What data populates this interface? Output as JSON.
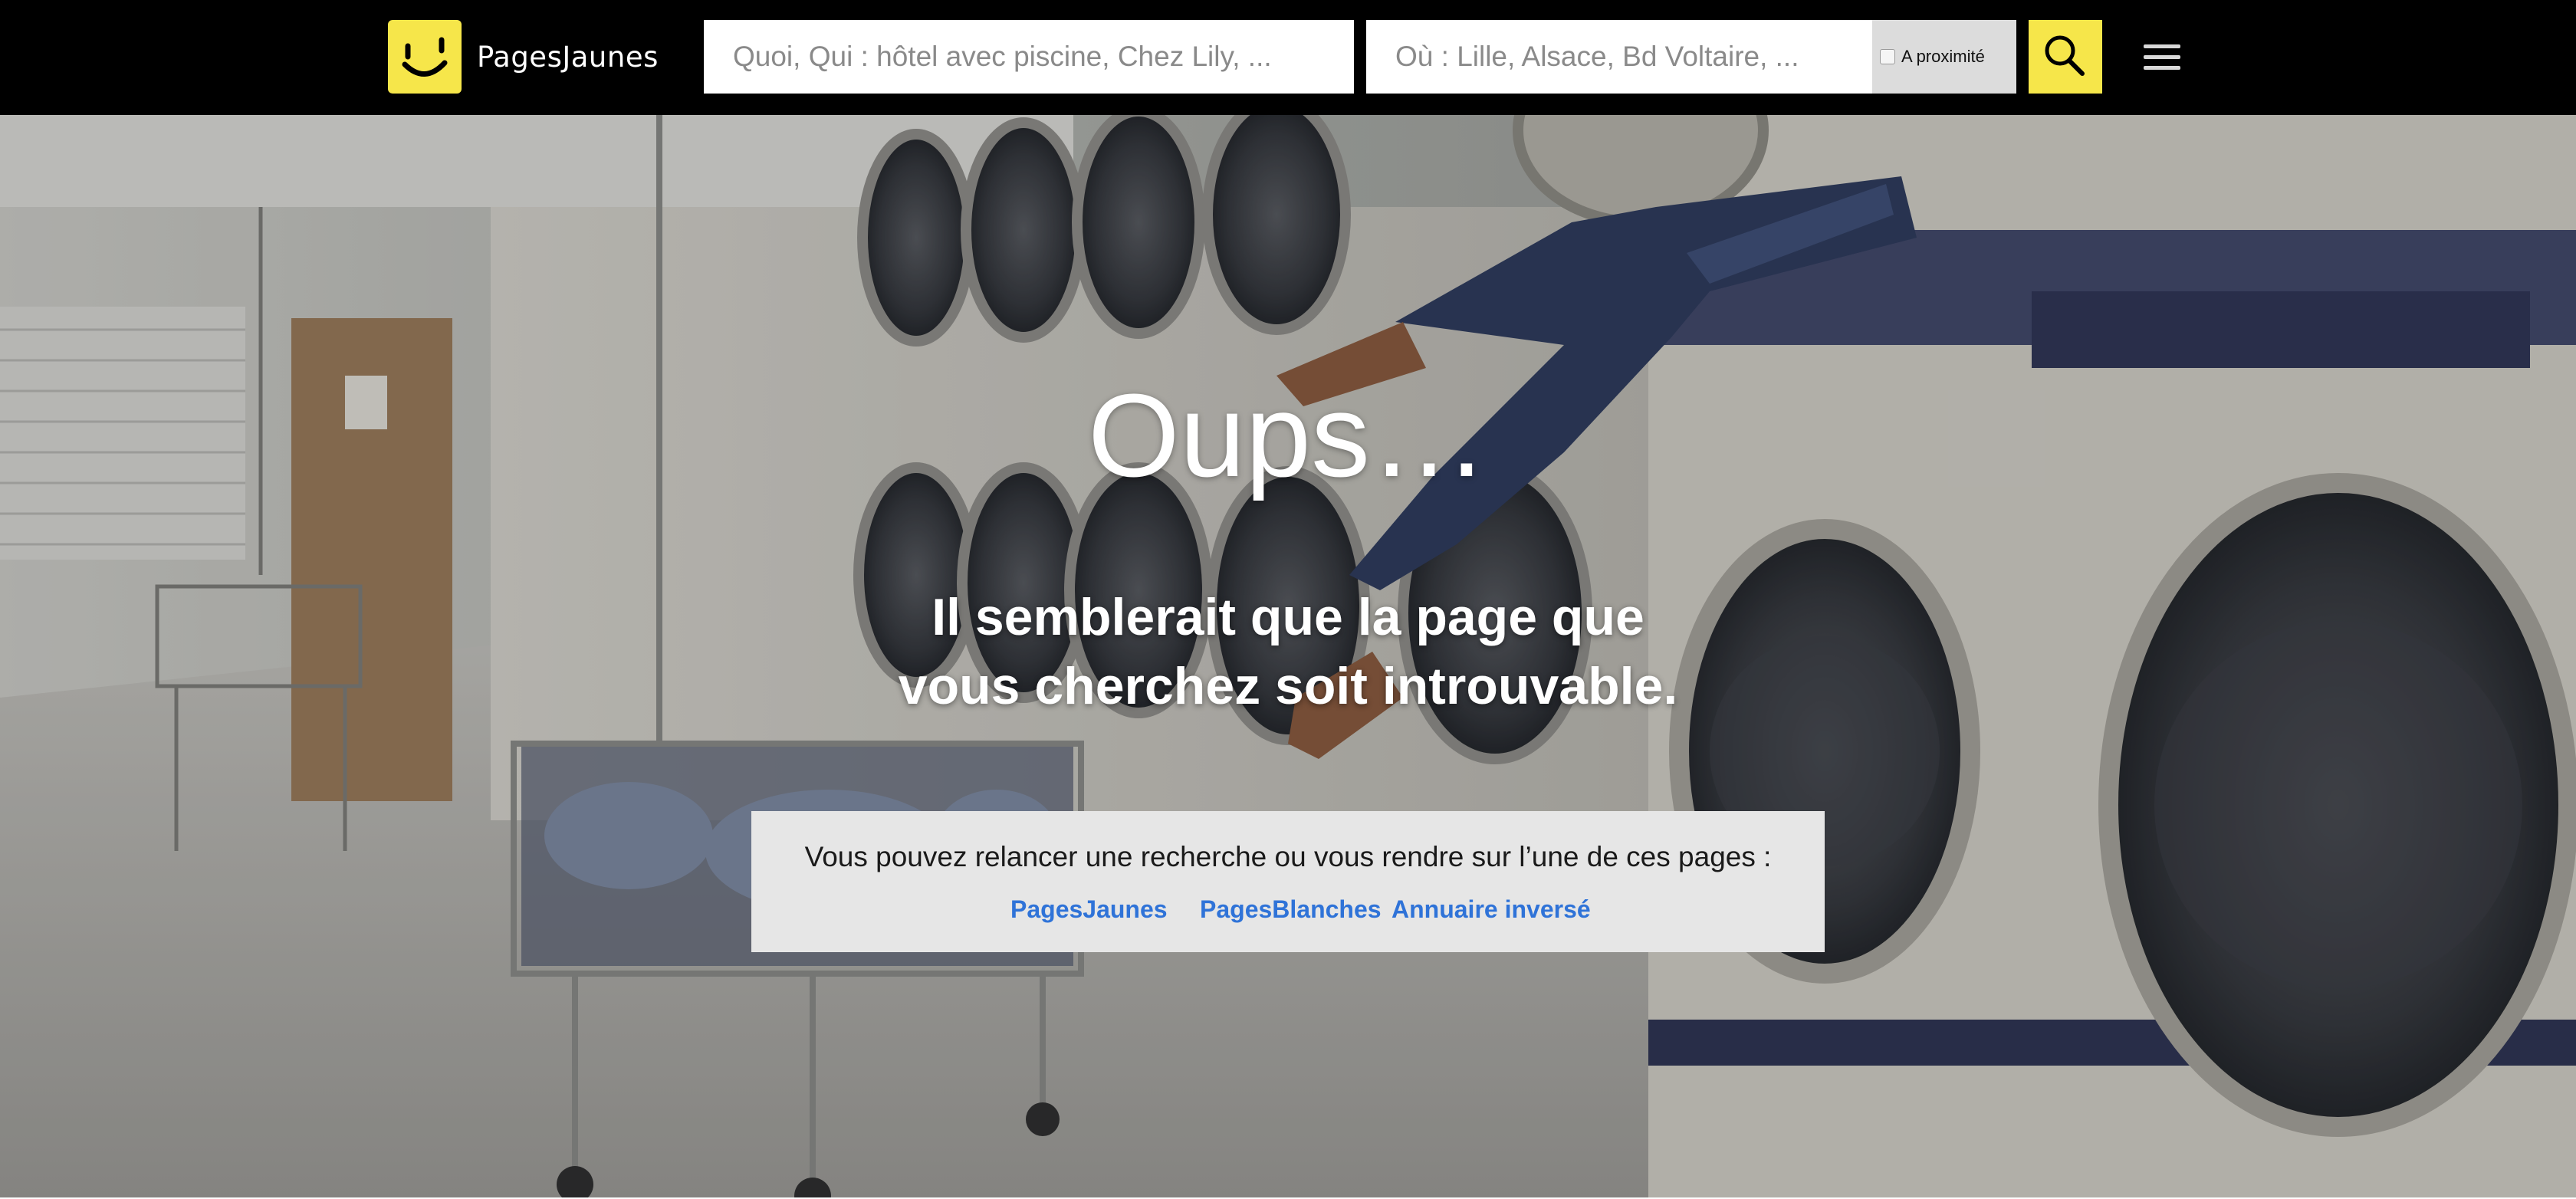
{
  "header": {
    "brand": "PagesJaunes",
    "search_what_placeholder": "Quoi, Qui : hôtel avec piscine, Chez Lily, ...",
    "search_where_placeholder": "Où : Lille, Alsace, Bd Voltaire, ...",
    "proximity_label": "A proximité",
    "proximity_checked": false,
    "search_icon": "search-icon",
    "menu_icon": "hamburger-menu-icon"
  },
  "hero": {
    "title": "Oups…",
    "subtitle_line1": "Il semblerait que la page que",
    "subtitle_line2": "vous cherchez soit introuvable.",
    "info_text": "Vous pouvez relancer une recherche ou vous rendre sur l’une de ces pages :",
    "links": [
      {
        "label": "PagesJaunes"
      },
      {
        "label": "PagesBlanches"
      },
      {
        "label": "Annuaire inversé"
      }
    ]
  },
  "colors": {
    "header_bg": "#000000",
    "brand_yellow": "#f6e64a",
    "link_blue": "#2f73d8",
    "info_box_bg": "#e6e6e6"
  }
}
